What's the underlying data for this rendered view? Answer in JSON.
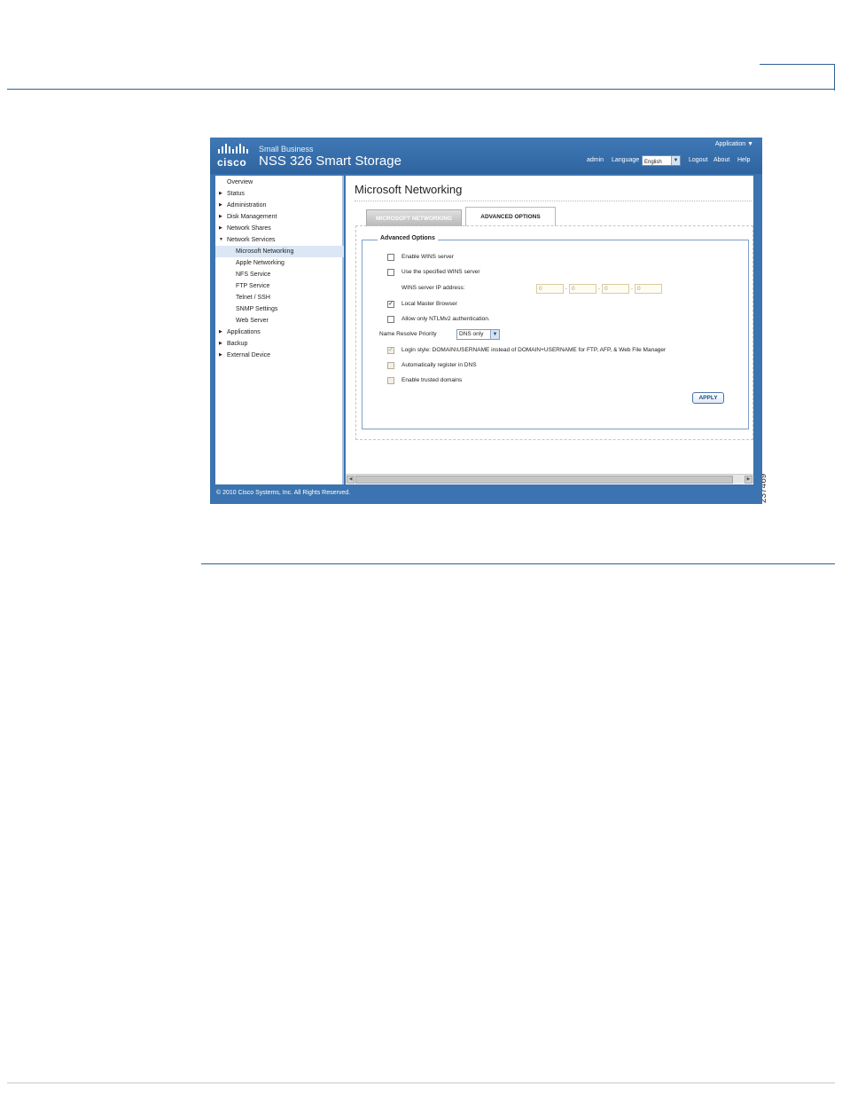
{
  "document": {
    "figure_id": "237469"
  },
  "app": {
    "logo_text": "cisco",
    "brand_sub": "Small Business",
    "brand_title": "NSS 326 Smart Storage",
    "application_menu": "Application",
    "user": "admin",
    "language_label": "Language",
    "language_value": "English",
    "logout": "Logout",
    "about": "About",
    "help": "Help",
    "footer": "© 2010 Cisco Systems, Inc. All Rights Reserved."
  },
  "sidebar": {
    "items": [
      {
        "label": "Overview"
      },
      {
        "label": "Status"
      },
      {
        "label": "Administration"
      },
      {
        "label": "Disk Management"
      },
      {
        "label": "Network Shares"
      },
      {
        "label": "Network Services"
      },
      {
        "label": "Microsoft Networking"
      },
      {
        "label": "Apple Networking"
      },
      {
        "label": "NFS Service"
      },
      {
        "label": "FTP Service"
      },
      {
        "label": "Telnet / SSH"
      },
      {
        "label": "SNMP Settings"
      },
      {
        "label": "Web Server"
      },
      {
        "label": "Applications"
      },
      {
        "label": "Backup"
      },
      {
        "label": "External Device"
      }
    ],
    "active": "Microsoft Networking"
  },
  "content": {
    "page_title": "Microsoft Networking",
    "tabs": [
      {
        "label": "MICROSOFT NETWORKING",
        "active": false
      },
      {
        "label": "ADVANCED OPTIONS",
        "active": true
      }
    ],
    "section_legend": "Advanced Options",
    "options": {
      "enable_wins": {
        "label": "Enable WINS server",
        "checked": false
      },
      "use_wins": {
        "label": "Use the specified WINS server",
        "checked": false
      },
      "wins_ip_label": "WINS server IP address:",
      "wins_ip": [
        "0",
        "0",
        "0",
        "0"
      ],
      "local_master": {
        "label": "Local Master Browser",
        "checked": true
      },
      "ntlmv2": {
        "label": "Allow only NTLMv2 authentication.",
        "checked": false
      },
      "name_resolve_label": "Name Resolve Priority",
      "name_resolve_value": "DNS only",
      "login_style": {
        "label": "Login style: DOMAIN\\USERNAME instead of DOMAIN+USERNAME for FTP, AFP, & Web File Manager",
        "checked": true
      },
      "auto_dns": {
        "label": "Automatically register in DNS",
        "checked": false
      },
      "trusted_domains": {
        "label": "Enable trusted domains",
        "checked": false
      }
    },
    "apply_label": "APPLY"
  },
  "colors": {
    "brand_blue": "#3b74b0",
    "rule_blue": "#2f5f8f",
    "fieldset_border": "#7e9fc7"
  }
}
